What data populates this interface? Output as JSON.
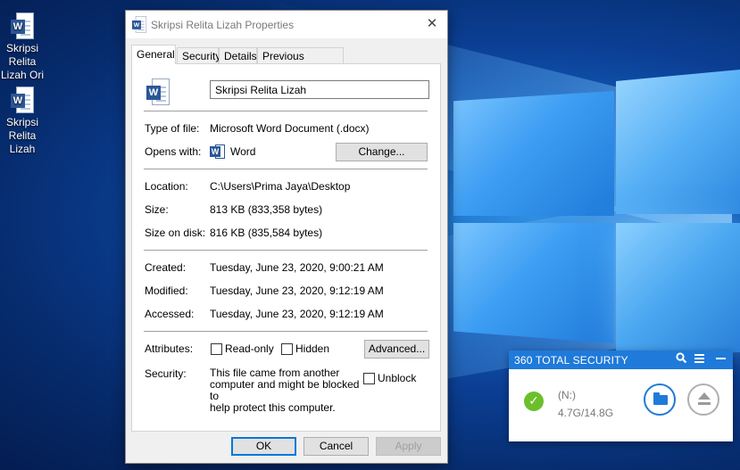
{
  "desktop": {
    "icons": [
      {
        "label_line1": "Skripsi Relita",
        "label_line2": "Lizah Ori",
        "icon": "word-document-icon"
      },
      {
        "label_line1": "Skripsi Relita",
        "label_line2": "Lizah",
        "icon": "word-document-icon"
      }
    ]
  },
  "dialog": {
    "title": "Skripsi Relita Lizah Properties",
    "close_glyph": "✕",
    "tabs": [
      {
        "label": "General",
        "active": true
      },
      {
        "label": "Security"
      },
      {
        "label": "Details"
      },
      {
        "label": "Previous Versions"
      }
    ],
    "file_name": "Skripsi Relita Lizah",
    "type_label": "Type of file:",
    "type_value": "Microsoft Word Document (.docx)",
    "opens_label": "Opens with:",
    "opens_value": "Word",
    "change_button": "Change...",
    "location_label": "Location:",
    "location_value": "C:\\Users\\Prima Jaya\\Desktop",
    "size_label": "Size:",
    "size_value": "813 KB (833,358 bytes)",
    "size_disk_label": "Size on disk:",
    "size_disk_value": "816 KB (835,584 bytes)",
    "created_label": "Created:",
    "created_value": "Tuesday, June 23, 2020, 9:00:21 AM",
    "modified_label": "Modified:",
    "modified_value": "Tuesday, June 23, 2020, 9:12:19 AM",
    "accessed_label": "Accessed:",
    "accessed_value": "Tuesday, June 23, 2020, 9:12:19 AM",
    "attributes_label": "Attributes:",
    "readonly_label": "Read-only",
    "readonly_checked": false,
    "hidden_label": "Hidden",
    "hidden_checked": false,
    "advanced_button": "Advanced...",
    "security_label": "Security:",
    "security_text_1": "This file came from another",
    "security_text_2": "computer and might be blocked to",
    "security_text_3": "help protect this computer.",
    "unblock_label": "Unblock",
    "unblock_checked": false,
    "ok_button": "OK",
    "cancel_button": "Cancel",
    "apply_button": "Apply"
  },
  "widget_360": {
    "title": "360 TOTAL SECURITY",
    "drive_label": "(N:)",
    "drive_usage": "4.7G/14.8G",
    "colors": {
      "header": "#1f7ad9",
      "ok": "#6cbf2a"
    }
  }
}
